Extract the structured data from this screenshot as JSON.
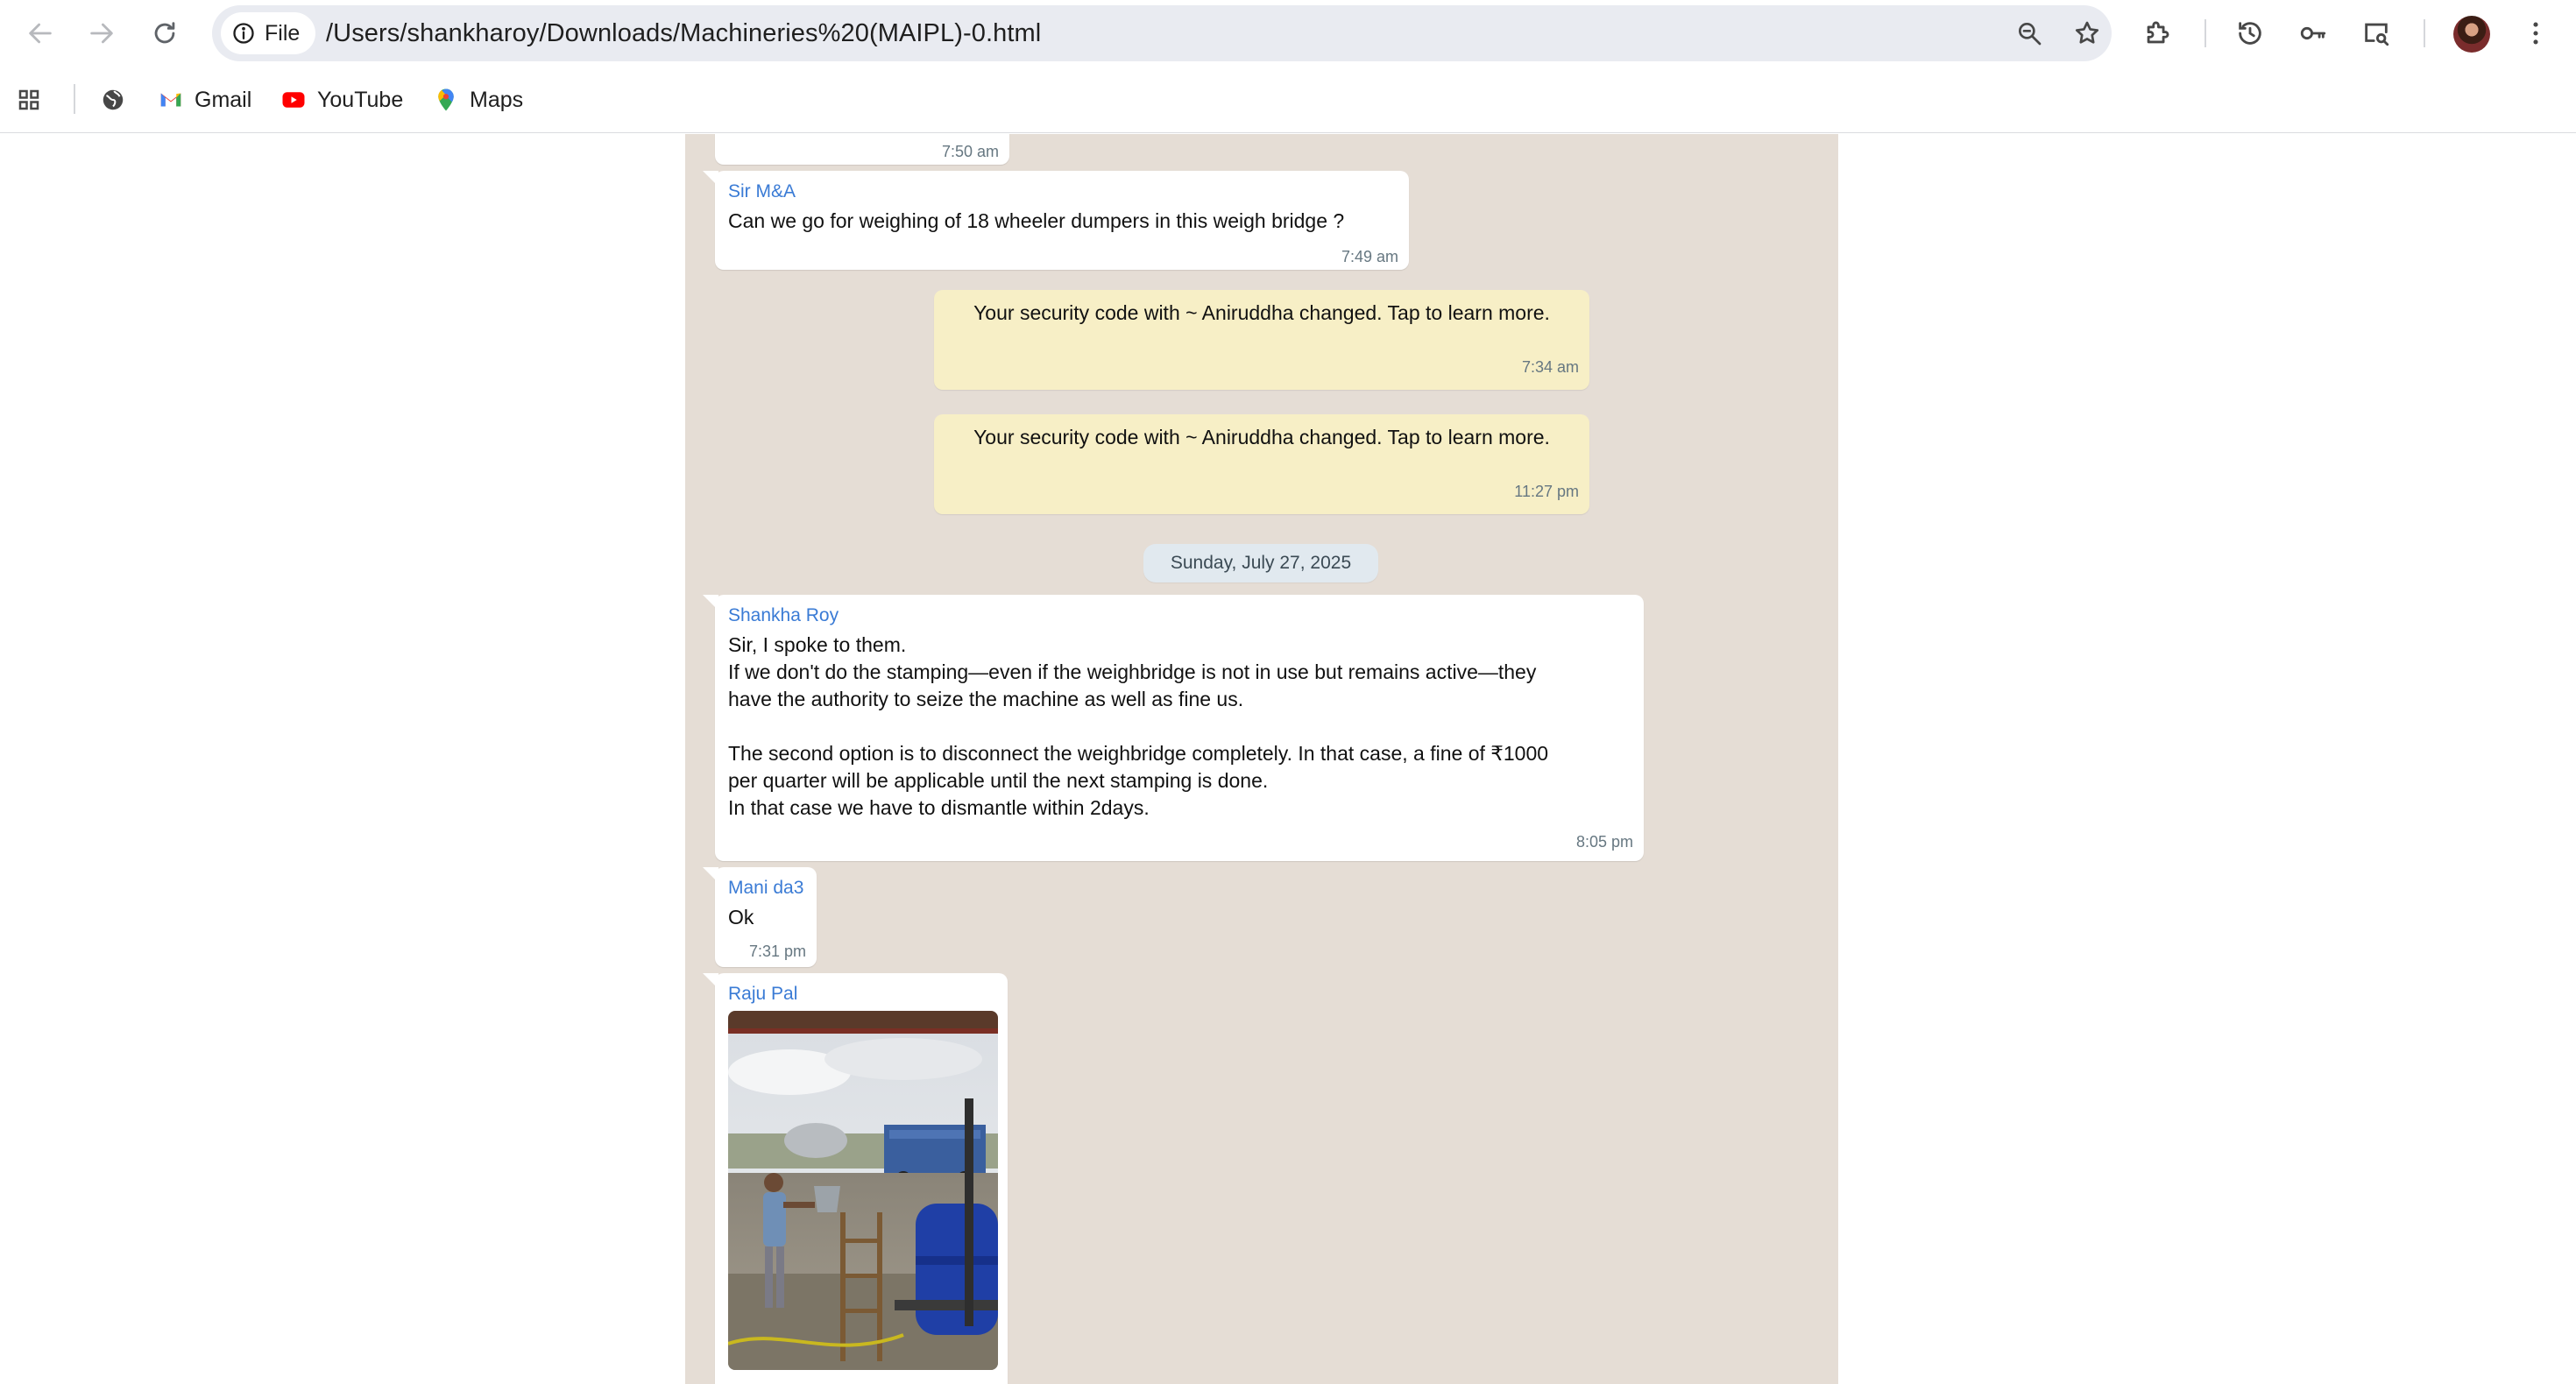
{
  "browser": {
    "nav": {
      "back": "back",
      "forward": "forward",
      "reload": "reload"
    },
    "omnibox": {
      "chip_label": "File",
      "url": "/Users/shankharoy/Downloads/Machineries%20(MAIPL)-0.html"
    },
    "bookmarks": [
      {
        "label": "Gmail",
        "icon": "gmail-icon"
      },
      {
        "label": "YouTube",
        "icon": "youtube-icon"
      },
      {
        "label": "Maps",
        "icon": "maps-icon"
      }
    ]
  },
  "chat": {
    "prev_message": {
      "time": "7:50 am"
    },
    "messages": [
      {
        "sender": "Sir M&A",
        "text": "Can we go for weighing of 18 wheeler dumpers in this weigh bridge ?",
        "time": "7:49 am"
      },
      {
        "sender": "Shankha Roy",
        "text": "Sir, I spoke to them.\nIf we don't do the stamping—even if the weighbridge is not in use but remains active—they\nhave the authority to seize the machine as well as fine us.\n\nThe second option is to disconnect the weighbridge completely. In that case, a fine of ₹1000\nper quarter will be applicable until the next stamping is done.\nIn that case we have to dismantle within 2days.",
        "time": "8:05 pm"
      },
      {
        "sender": "Mani da3",
        "text": "Ok",
        "time": "7:31 pm"
      },
      {
        "sender": "Raju Pal",
        "attachment": "photo"
      }
    ],
    "system_messages": [
      {
        "text": "Your security code with ~ Aniruddha changed. Tap to learn more.",
        "time": "7:34 am"
      },
      {
        "text": "Your security code with ~ Aniruddha changed. Tap to learn more.",
        "time": "11:27 pm"
      }
    ],
    "date_divider": "Sunday, July 27, 2025"
  },
  "colors": {
    "chat_background": "#e5ddd5",
    "system_bubble": "#f7efc6",
    "sender_name": "#3a7bd5"
  }
}
